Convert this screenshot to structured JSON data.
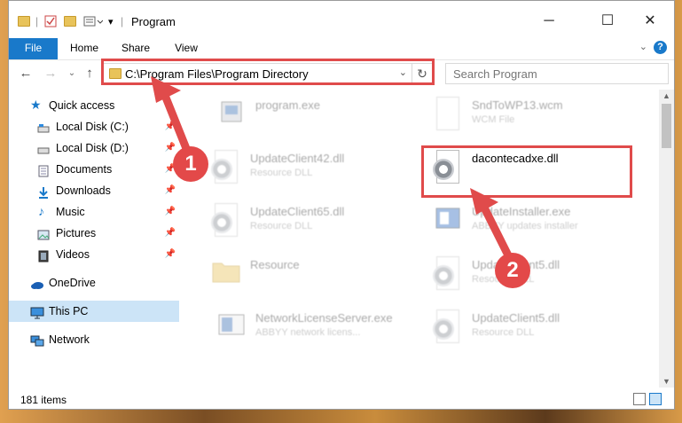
{
  "window": {
    "title": "Program"
  },
  "ribbon": {
    "tabs": [
      "File",
      "Home",
      "Share",
      "View"
    ]
  },
  "address": {
    "path": "C:\\Program Files\\Program Directory",
    "search_placeholder": "Search Program"
  },
  "sidebar": {
    "items": [
      {
        "label": "Quick access"
      },
      {
        "label": "Local Disk (C:)"
      },
      {
        "label": "Local Disk (D:)"
      },
      {
        "label": "Documents"
      },
      {
        "label": "Downloads"
      },
      {
        "label": "Music"
      },
      {
        "label": "Pictures"
      },
      {
        "label": "Videos"
      },
      {
        "label": "OneDrive"
      },
      {
        "label": "This PC"
      },
      {
        "label": "Network"
      }
    ]
  },
  "files": [
    {
      "name": "program.exe",
      "desc": ""
    },
    {
      "name": "SndToWP13.wcm",
      "desc": "WCM File"
    },
    {
      "name": "UpdateClient42.dll",
      "desc": "Resource DLL"
    },
    {
      "name": "dacontecadxe.dll",
      "desc": ""
    },
    {
      "name": "UpdateClient65.dll",
      "desc": "Resource DLL"
    },
    {
      "name": "UpdateInstaller.exe",
      "desc": "ABBYY updates installer"
    },
    {
      "name": "Resource",
      "desc": ""
    },
    {
      "name": "UpdateClient5.dll",
      "desc": "Resource DLL"
    },
    {
      "name": "NetworkLicenseServer.exe",
      "desc": "ABBYY network licens..."
    },
    {
      "name": "UpdateClient5.dll",
      "desc": "Resource DLL"
    }
  ],
  "status": {
    "item_count": "181 items"
  },
  "annotations": {
    "step1": "1",
    "step2": "2"
  },
  "colors": {
    "highlight_red": "#e04b4b",
    "accent_blue": "#1979ca"
  }
}
